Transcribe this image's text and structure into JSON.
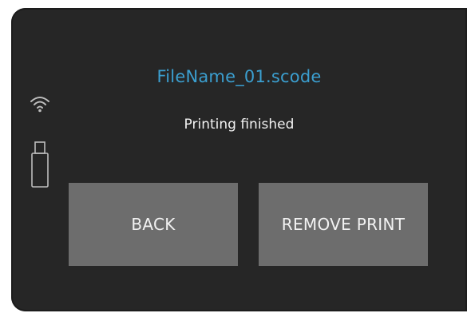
{
  "header": {
    "filename": "FileName_01.scode"
  },
  "status": {
    "message": "Printing finished"
  },
  "actions": {
    "back_label": "BACK",
    "remove_label": "REMOVE PRINT"
  },
  "indicators": {
    "wifi_icon": "wifi-icon",
    "usb_icon": "usb-drive-icon"
  },
  "colors": {
    "background": "#262626",
    "accent": "#3b9fd0",
    "button": "#6d6d6d",
    "text": "#f2f2f2"
  }
}
